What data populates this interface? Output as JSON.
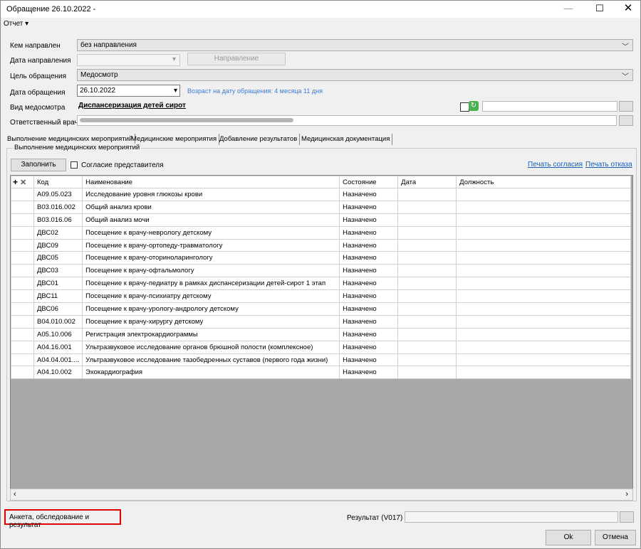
{
  "window": {
    "title": "Обращение 26.10.2022 -",
    "min_icon": "—",
    "max_icon": "☐",
    "close_icon": "✕"
  },
  "menu": {
    "report": "Отчет ▾"
  },
  "form": {
    "referred_by_label": "Кем направлен",
    "referred_by_value": "без направления",
    "referral_date_label": "Дата направления",
    "referral_date_value": "",
    "referral_button": "Направление",
    "purpose_label": "Цель обращения",
    "purpose_value": "Медосмотр",
    "visit_date_label": "Дата обращения",
    "visit_date_value": "26.10.2022",
    "age_info": "Возраст на дату обращения: 4 месяца 11 дня",
    "exam_type_label": "Вид медосмотра",
    "exam_type_value": "Диспансеризация детей сирот",
    "doctor_label": "Ответственный врач",
    "doctor_value": ""
  },
  "tabs": [
    "Выполнение медицинских мероприятий",
    "Медицинские мероприятия",
    "Добавление результатов",
    "Медицинская документация"
  ],
  "group": {
    "title": "Выполнение медицинских мероприятий",
    "fill_button": "Заполнить",
    "consent_label": "Согласие представителя",
    "print_consent": "Печать согласия",
    "print_refusal": "Печать отказа"
  },
  "table": {
    "columns": [
      "Код",
      "Наименование",
      "Состояние",
      "Дата",
      "Должность"
    ],
    "rows": [
      [
        "A09.05.023",
        "Исследование уровня глюкозы крови",
        "Назначено",
        "",
        ""
      ],
      [
        "B03.016.002",
        "Общий анализ крови",
        "Назначено",
        "",
        ""
      ],
      [
        "B03.016.06",
        "Общий анализ мочи",
        "Назначено",
        "",
        ""
      ],
      [
        "ДВС02",
        "Посещение к врачу-неврологу детскому",
        "Назначено",
        "",
        ""
      ],
      [
        "ДВС09",
        "Посещение к врачу-ортопеду-травматологу",
        "Назначено",
        "",
        ""
      ],
      [
        "ДВС05",
        "Посещение к врачу-оториноларингологу",
        "Назначено",
        "",
        ""
      ],
      [
        "ДВС03",
        "Посещение к врачу-офтальмологу",
        "Назначено",
        "",
        ""
      ],
      [
        "ДВС01",
        "Посещение к врачу-педиатру в рамках диспансеризации детей-сирот 1 этап",
        "Назначено",
        "",
        ""
      ],
      [
        "ДВС11",
        "Посещение к врачу-психиатру детскому",
        "Назначено",
        "",
        ""
      ],
      [
        "ДВС06",
        "Посещение к врачу-урологу-андрологу детскому",
        "Назначено",
        "",
        ""
      ],
      [
        "B04.010.002",
        "Посещение к врачу-хирургу детскому",
        "Назначено",
        "",
        ""
      ],
      [
        "A05.10.006",
        "Регистрация электрокардиограммы",
        "Назначено",
        "",
        ""
      ],
      [
        "A04.16.001",
        "Ультразвуковое исследование органов брюшной полости (комплексное)",
        "Назначено",
        "",
        ""
      ],
      [
        "A04.04.001....",
        "Ультразвуковое исследование тазобедренных суставов (первого года жизни)",
        "Назначено",
        "",
        ""
      ],
      [
        "A04.10.002",
        "Эхокардиография",
        "Назначено",
        "",
        ""
      ]
    ]
  },
  "footer": {
    "survey_link": "Анкета, обследование и результат",
    "result_label": "Результат (V017)",
    "result_value": "",
    "ok_button": "Ok",
    "cancel_button": "Отмена"
  }
}
